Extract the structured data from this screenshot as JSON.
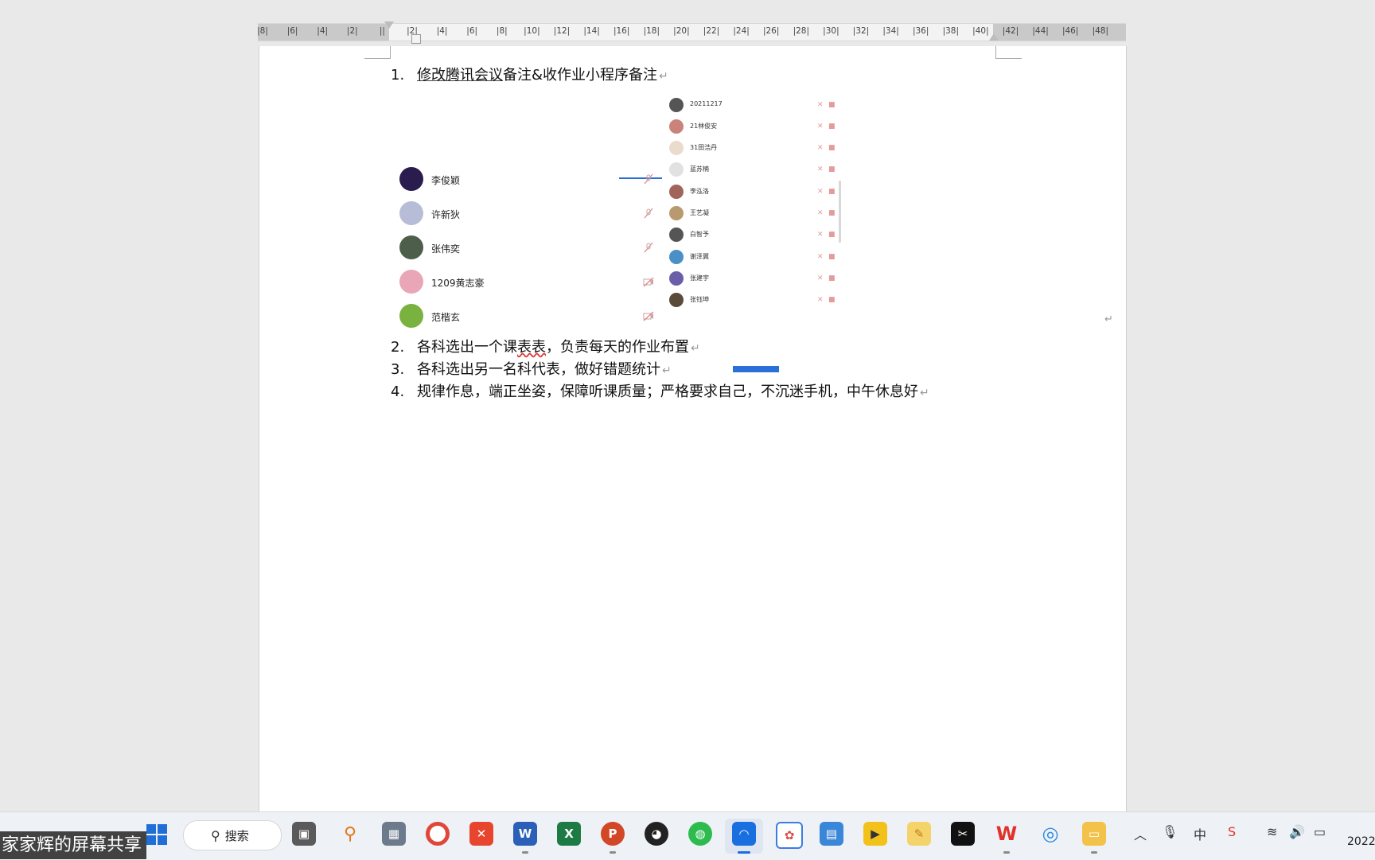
{
  "ruler": {
    "labels": [
      "8",
      "6",
      "4",
      "2",
      "",
      "2",
      "4",
      "6",
      "8",
      "10",
      "12",
      "14",
      "16",
      "18",
      "20",
      "22",
      "24",
      "26",
      "28",
      "30",
      "32",
      "34",
      "36",
      "38",
      "40",
      "42",
      "44",
      "46",
      "48"
    ]
  },
  "document": {
    "items": [
      {
        "num": "1.",
        "link_text": "修改腾讯会议",
        "text": "备注&收作业小程序备注",
        "mark": "↵"
      },
      {
        "num": "2.",
        "pre": "各科选出一个课",
        "wavy": "表表",
        "text": "，负责每天的作业布置",
        "mark": "↵"
      },
      {
        "num": "3.",
        "text": "各科选出另一名科代表，做好错题统计",
        "mark": "↵"
      },
      {
        "num": "4.",
        "text": "规律作息，端正坐姿，保障听课质量；严格要求自己，不沉迷手机，中午休息好",
        "mark": "↵"
      }
    ],
    "image_return_mark": "↵",
    "embedded_image": {
      "left_participants": [
        {
          "name": "李俊颖",
          "color": "#2a1c4e"
        },
        {
          "name": "许新狄",
          "color": "#b7bdd6"
        },
        {
          "name": "张伟奕",
          "color": "#4d5f4a"
        },
        {
          "name": "1209黄志豪",
          "color": "#e8a6b6"
        },
        {
          "name": "范楷玄",
          "color": "#7ab23f"
        }
      ],
      "right_participants": [
        {
          "name": "20211217",
          "color": "#555"
        },
        {
          "name": "21林俊安",
          "color": "#c9837a"
        },
        {
          "name": "31田浩丹",
          "color": "#e9dccc"
        },
        {
          "name": "蓝苏楠",
          "color": "#e1e1e1"
        },
        {
          "name": "李泓洛",
          "color": "#a0645a"
        },
        {
          "name": "王艺凝",
          "color": "#b89a6e"
        },
        {
          "name": "白智予",
          "color": "#555"
        },
        {
          "name": "谢泽翼",
          "color": "#4b8fc7"
        },
        {
          "name": "张建宇",
          "color": "#6b5ea8"
        },
        {
          "name": "张钰坤",
          "color": "#5a4a3a"
        }
      ]
    }
  },
  "taskbar": {
    "share_label": "家家辉的屏幕共享",
    "search_text": "搜索",
    "clock": "2022"
  }
}
